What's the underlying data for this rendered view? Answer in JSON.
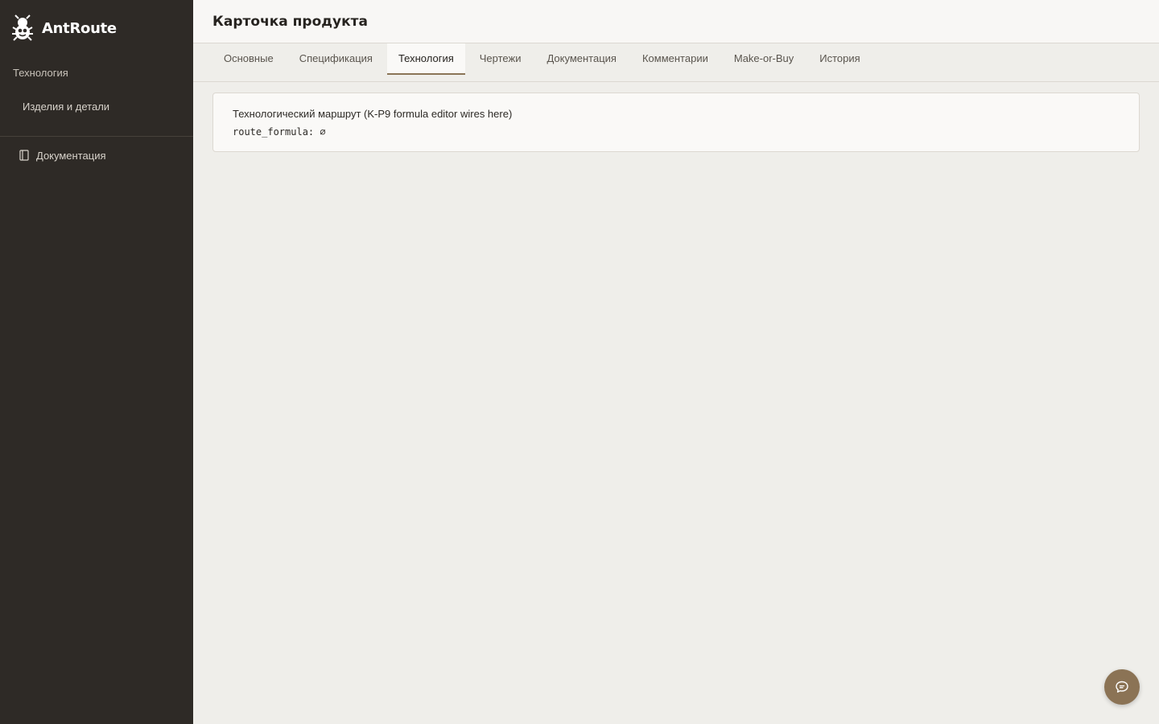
{
  "brand": {
    "name": "AntRoute",
    "logo_icon": "ant-logo-icon"
  },
  "sidebar": {
    "section_label": "Технология",
    "items": [
      {
        "label": "Изделия и детали"
      }
    ],
    "footer_link": {
      "label": "Документация",
      "icon": "document-icon"
    }
  },
  "header": {
    "title": "Карточка продукта"
  },
  "tabs": [
    {
      "label": "Основные",
      "active": false
    },
    {
      "label": "Спецификация",
      "active": false
    },
    {
      "label": "Технология",
      "active": true
    },
    {
      "label": "Чертежи",
      "active": false
    },
    {
      "label": "Документация",
      "active": false
    },
    {
      "label": "Комментарии",
      "active": false
    },
    {
      "label": "Make-or-Buy",
      "active": false
    },
    {
      "label": "История",
      "active": false
    }
  ],
  "card": {
    "title": "Технологический маршрут (K-P9 formula editor wires here)",
    "code": "route_formula: ∅"
  },
  "chat": {
    "icon": "chat-icon"
  },
  "colors": {
    "sidebar_bg": "#2e2a26",
    "accent": "#8b7355",
    "page_bg": "#efeeea"
  }
}
